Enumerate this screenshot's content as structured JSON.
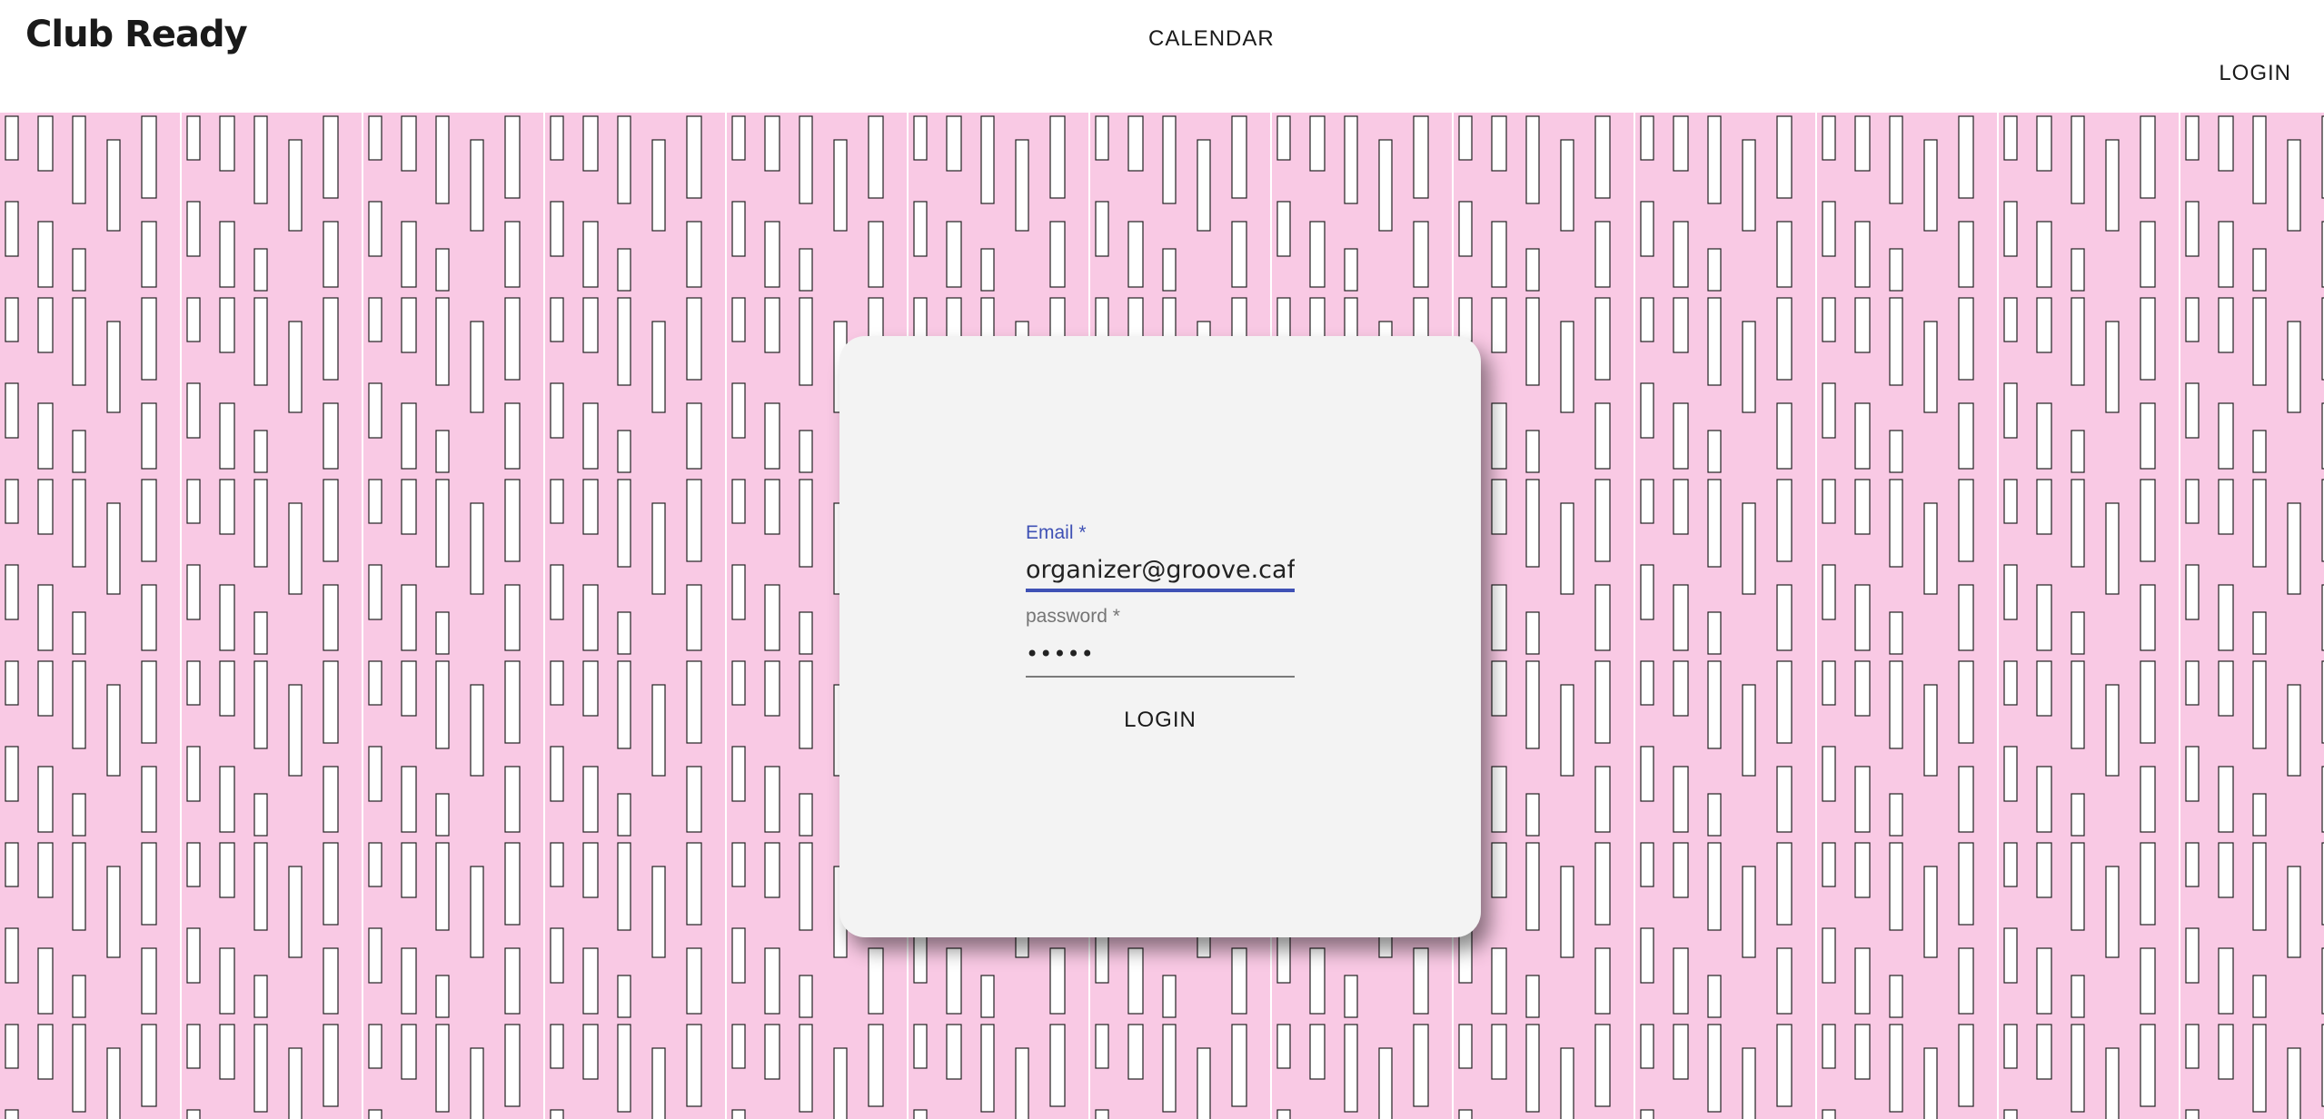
{
  "app": {
    "title": "Club Ready"
  },
  "nav": {
    "calendar": "CALENDAR",
    "login": "LOGIN"
  },
  "login_form": {
    "email": {
      "label": "Email *",
      "value": "organizer@groove.cafe"
    },
    "password": {
      "label": "password *",
      "value": "•••••"
    },
    "submit_label": "LOGIN"
  },
  "colors": {
    "accent": "#3f51b5",
    "pattern_background": "#f9c9e4",
    "card_background": "#f3f3f3"
  }
}
